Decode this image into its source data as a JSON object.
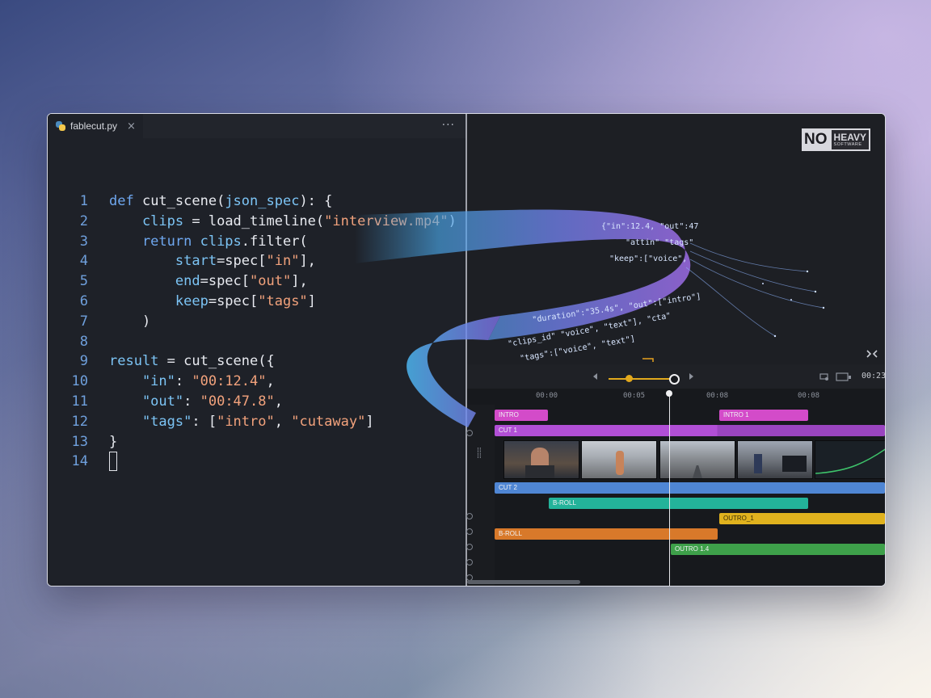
{
  "editor": {
    "tab_label": "fablecut.py",
    "tab_close": "×",
    "more": "···",
    "lines": [
      {
        "n": "1",
        "tokens": [
          {
            "t": "def ",
            "c": "k"
          },
          {
            "t": "cut_scene(",
            "c": "f"
          },
          {
            "t": "json_spec",
            "c": "v"
          },
          {
            "t": "): {",
            "c": "p"
          }
        ]
      },
      {
        "n": "2",
        "tokens": [
          {
            "t": "    clips",
            "c": "v"
          },
          {
            "t": " = ",
            "c": "p"
          },
          {
            "t": "load_timeline(",
            "c": "f"
          },
          {
            "t": "\"interview.mp4\"",
            "c": "s"
          },
          {
            "t": ")",
            "c": "p"
          }
        ]
      },
      {
        "n": "3",
        "tokens": [
          {
            "t": "    return ",
            "c": "k"
          },
          {
            "t": "clips",
            "c": "v"
          },
          {
            "t": ".filter(",
            "c": "f"
          }
        ]
      },
      {
        "n": "4",
        "tokens": [
          {
            "t": "        start",
            "c": "v"
          },
          {
            "t": "=spec[",
            "c": "p"
          },
          {
            "t": "\"in\"",
            "c": "s"
          },
          {
            "t": "],",
            "c": "p"
          }
        ]
      },
      {
        "n": "5",
        "tokens": [
          {
            "t": "        end",
            "c": "v"
          },
          {
            "t": "=spec[",
            "c": "p"
          },
          {
            "t": "\"out\"",
            "c": "s"
          },
          {
            "t": "],",
            "c": "p"
          }
        ]
      },
      {
        "n": "6",
        "tokens": [
          {
            "t": "        keep",
            "c": "v"
          },
          {
            "t": "=spec[",
            "c": "p"
          },
          {
            "t": "\"tags\"",
            "c": "s"
          },
          {
            "t": "]",
            "c": "p"
          }
        ]
      },
      {
        "n": "7",
        "tokens": [
          {
            "t": "    )",
            "c": "p"
          }
        ]
      },
      {
        "n": "8",
        "tokens": []
      },
      {
        "n": "9",
        "tokens": [
          {
            "t": "result",
            "c": "v"
          },
          {
            "t": " = ",
            "c": "p"
          },
          {
            "t": "cut_scene({",
            "c": "f"
          }
        ]
      },
      {
        "n": "10",
        "tokens": [
          {
            "t": "    \"in\"",
            "c": "v"
          },
          {
            "t": ": ",
            "c": "p"
          },
          {
            "t": "\"00:12.4\"",
            "c": "s"
          },
          {
            "t": ",",
            "c": "p"
          }
        ]
      },
      {
        "n": "11",
        "tokens": [
          {
            "t": "    \"out\"",
            "c": "v"
          },
          {
            "t": ": ",
            "c": "p"
          },
          {
            "t": "\"00:47.8\"",
            "c": "s"
          },
          {
            "t": ",",
            "c": "p"
          }
        ]
      },
      {
        "n": "12",
        "tokens": [
          {
            "t": "    \"tags\"",
            "c": "v"
          },
          {
            "t": ": [",
            "c": "p"
          },
          {
            "t": "\"intro\"",
            "c": "s"
          },
          {
            "t": ", ",
            "c": "p"
          },
          {
            "t": "\"cutaway\"",
            "c": "s"
          },
          {
            "t": "]",
            "c": "p"
          }
        ]
      },
      {
        "n": "13",
        "tokens": [
          {
            "t": "}",
            "c": "p"
          }
        ]
      },
      {
        "n": "14",
        "tokens": [],
        "cursor": true
      }
    ]
  },
  "ribbon_text": [
    "{\"in\":12.4, \"out\":47",
    "\"attin\" \"tags\"",
    "\"keep\":[\"voice\",",
    "\"duration\":\"35.4s\", \"out\":[\"intro\"]",
    "\"clips_id\" \"voice\", \"text\"], \"cta\"",
    "\"tags\":[\"voice\", \"text\"]"
  ],
  "logo": {
    "no": "NO",
    "heavy": "HEAVY",
    "sub": "SOFTWARE"
  },
  "timeline": {
    "time_readout": "00:23",
    "ruler": [
      "00:00",
      "00:05",
      "00:08",
      "00:08"
    ],
    "clips": [
      {
        "label": "INTRO",
        "color": "#d34bc9"
      },
      {
        "label": "INTRO 1",
        "color": "#d34bc9"
      },
      {
        "label": "CUT 1",
        "color": "#b14fd6"
      },
      {
        "label": "CUT 2",
        "color": "#4f86d4"
      },
      {
        "label": "B-ROLL",
        "color": "#23b39a"
      },
      {
        "label": "OUTRO_1",
        "color": "#e0b21e"
      },
      {
        "label": "B-ROLL",
        "color": "#d8792a"
      },
      {
        "label": "OUTRO 1.4",
        "color": "#3ea04a"
      }
    ]
  }
}
